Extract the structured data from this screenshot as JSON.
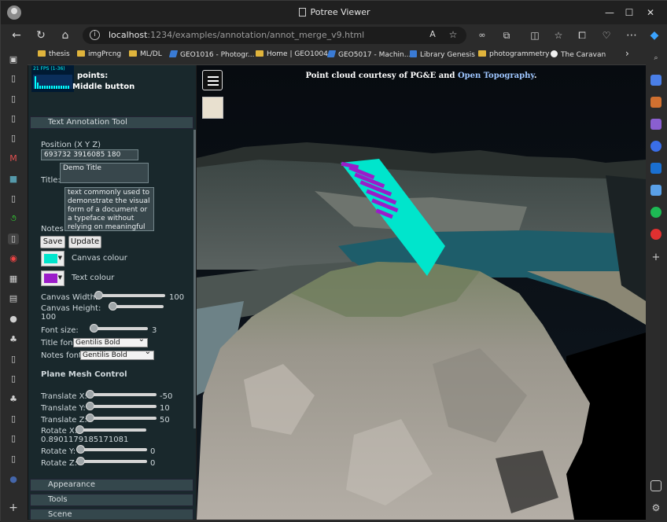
{
  "browser": {
    "window_title": "Potree Viewer",
    "url_host": "localhost",
    "url_path": ":1234/examples/annotation/annot_merge_v9.html",
    "bookmarks": [
      {
        "label": "thesis",
        "icon": "folder-icon"
      },
      {
        "label": "imgPrcng",
        "icon": "folder-icon"
      },
      {
        "label": "ML/DL",
        "icon": "folder-icon"
      },
      {
        "label": "GEO1016 - Photogr...",
        "icon": "tu-icon"
      },
      {
        "label": "Home | GEO1004",
        "icon": "folder-icon"
      },
      {
        "label": "GEO5017 - Machin...",
        "icon": "tu-icon"
      },
      {
        "label": "Library Genesis",
        "icon": "book-icon"
      },
      {
        "label": "photogrammetry",
        "icon": "folder-icon"
      },
      {
        "label": "The Caravan",
        "icon": "caravan-icon"
      }
    ]
  },
  "panel": {
    "fps_label": "21 FPS (1-36)",
    "points_label": "points:",
    "middle_button_label": "Middle button",
    "sections": {
      "text_annotation": "Text Annotation Tool",
      "appearance": "Appearance",
      "tools": "Tools",
      "scene": "Scene"
    },
    "position_label": "Position (X Y Z)",
    "position_value": "693732 3916085 180",
    "title_label": "Title:",
    "title_value": "Demo Title",
    "notes_label": "Notes:",
    "notes_value": "text commonly used to demonstrate the visual form of a document or a typeface without relying on meaningful content.",
    "save_label": "Save",
    "update_label": "Update",
    "canvas_colour_label": "Canvas colour",
    "text_colour_label": "Text colour",
    "canvas_colour": "#00e5cc",
    "text_colour": "#9b1cc9",
    "canvas_width_label": "Canvas Width:",
    "canvas_width_value": "100",
    "canvas_height_label": "Canvas Height:",
    "canvas_height_value": "100",
    "font_size_label": "Font size:",
    "font_size_value": "3",
    "title_font_label": "Title font:",
    "title_font_value": "Gentilis Bold",
    "notes_font_label": "Notes font:",
    "notes_font_value": "Gentilis Bold",
    "plane_mesh_label": "Plane Mesh Control",
    "translate_x_label": "Translate X:",
    "translate_x_value": "-50",
    "translate_y_label": "Translate Y:",
    "translate_y_value": "10",
    "translate_z_label": "Translate Z:",
    "translate_z_value": "50",
    "rotate_x_label": "Rotate X:",
    "rotate_x_value": "0.8901179185171081",
    "rotate_y_label": "Rotate Y:",
    "rotate_y_value": "0",
    "rotate_z_label": "Rotate Z:",
    "rotate_z_value": "0"
  },
  "viewer": {
    "credit_prefix": "Point cloud courtesy of PG&E and",
    "credit_link": "Open Topography",
    "credit_suffix": "."
  }
}
